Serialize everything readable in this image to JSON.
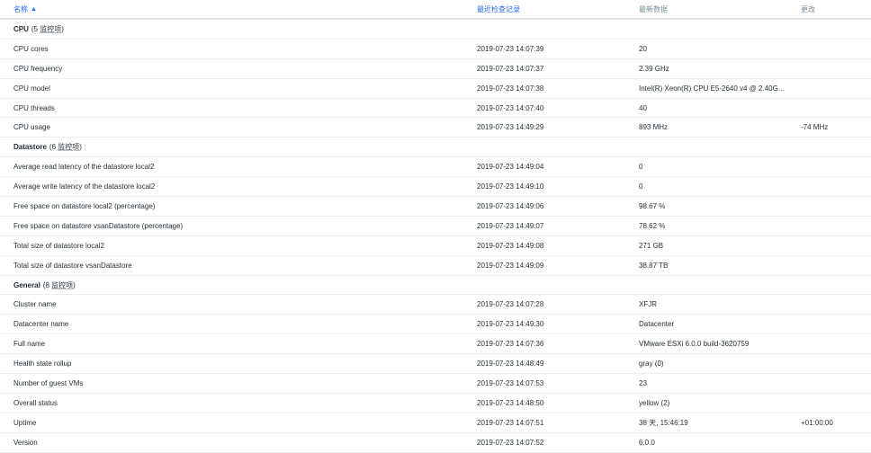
{
  "header": {
    "name": "名称",
    "last_check": "最近检查记录",
    "latest_data": "最新数据",
    "change": "更改"
  },
  "groups": [
    {
      "title": "CPU",
      "count_prefix": "(5 ",
      "count_link": "监控项",
      "count_suffix": ")",
      "items": [
        {
          "name": "CPU cores",
          "time": "2019-07-23 14:07:39",
          "value": "20",
          "change": ""
        },
        {
          "name": "CPU frequency",
          "time": "2019-07-23 14:07:37",
          "value": "2.39 GHz",
          "change": ""
        },
        {
          "name": "CPU model",
          "time": "2019-07-23 14:07:38",
          "value": "Intel(R) Xeon(R) CPU E5-2640 v4 @ 2.40G...",
          "change": ""
        },
        {
          "name": "CPU threads",
          "time": "2019-07-23 14:07:40",
          "value": "40",
          "change": ""
        },
        {
          "name": "CPU usage",
          "time": "2019-07-23 14:49:29",
          "value": "893 MHz",
          "change": "-74 MHz"
        }
      ]
    },
    {
      "title": "Datastore",
      "count_prefix": "(6 ",
      "count_link": "监控项",
      "count_suffix": ")",
      "items": [
        {
          "name": "Average read latency of the datastore local2",
          "time": "2019-07-23 14:49:04",
          "value": "0",
          "change": ""
        },
        {
          "name": "Average write latency of the datastore local2",
          "time": "2019-07-23 14:49:10",
          "value": "0",
          "change": ""
        },
        {
          "name": "Free space on datastore local2 (percentage)",
          "time": "2019-07-23 14:49:06",
          "value": "98.67 %",
          "change": ""
        },
        {
          "name": "Free space on datastore vsanDatastore (percentage)",
          "time": "2019-07-23 14:49:07",
          "value": "78.62 %",
          "change": ""
        },
        {
          "name": "Total size of datastore local2",
          "time": "2019-07-23 14:49:08",
          "value": "271 GB",
          "change": ""
        },
        {
          "name": "Total size of datastore vsanDatastore",
          "time": "2019-07-23 14:49:09",
          "value": "38.87 TB",
          "change": ""
        }
      ]
    },
    {
      "title": "General",
      "count_prefix": "(8 ",
      "count_link": "监控项",
      "count_suffix": ")",
      "items": [
        {
          "name": "Cluster name",
          "time": "2019-07-23 14:07:28",
          "value": "XFJR",
          "change": ""
        },
        {
          "name": "Datacenter name",
          "time": "2019-07-23 14:49:30",
          "value": "Datacenter",
          "change": ""
        },
        {
          "name": "Full name",
          "time": "2019-07-23 14:07:36",
          "value": "VMware ESXi 6.0.0 build-3620759",
          "change": ""
        },
        {
          "name": "Health state rollup",
          "time": "2019-07-23 14:48:49",
          "value": "gray (0)",
          "change": ""
        },
        {
          "name": "Number of guest VMs",
          "time": "2019-07-23 14:07:53",
          "value": "23",
          "change": ""
        },
        {
          "name": "Overall status",
          "time": "2019-07-23 14:48:50",
          "value": "yellow (2)",
          "change": ""
        },
        {
          "name": "Uptime",
          "time": "2019-07-23 14:07:51",
          "value": "38 天, 15:46:19",
          "change": "+01:00:00"
        },
        {
          "name": "Version",
          "time": "2019-07-23 14:07:52",
          "value": "6.0.0",
          "change": ""
        }
      ]
    }
  ]
}
